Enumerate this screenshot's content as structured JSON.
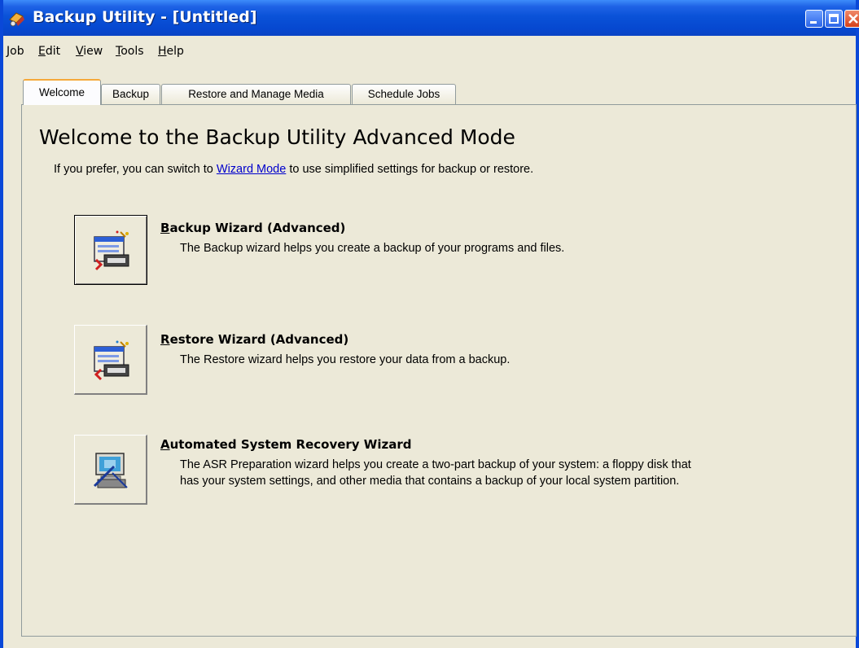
{
  "window": {
    "title": "Backup Utility - [Untitled]",
    "icon": "backup-utility-icon",
    "title_bar_color": "#0a52d8"
  },
  "menu": {
    "items": [
      {
        "first": "J",
        "rest": "ob"
      },
      {
        "first": "E",
        "rest": "dit"
      },
      {
        "first": "V",
        "rest": "iew"
      },
      {
        "first": "T",
        "rest": "ools"
      },
      {
        "first": "H",
        "rest": "elp"
      }
    ]
  },
  "tabs": [
    {
      "label": "Welcome"
    },
    {
      "label": "Backup"
    },
    {
      "label": "Restore and Manage Media"
    },
    {
      "label": "Schedule Jobs"
    }
  ],
  "welcome": {
    "heading": "Welcome to the Backup Utility Advanced Mode",
    "intro_before": "If you prefer, you can switch to ",
    "intro_link": "Wizard Mode",
    "intro_after": " to use simplified settings for backup or restore."
  },
  "wizards": [
    {
      "icon": "backup-wizard-icon",
      "title_first": "B",
      "title_rest": "ackup Wizard (Advanced)",
      "description": "The Backup wizard helps you create a backup of your programs and files."
    },
    {
      "icon": "restore-wizard-icon",
      "title_first": "R",
      "title_rest": "estore Wizard (Advanced)",
      "description": "The Restore wizard helps you restore your data from a backup."
    },
    {
      "icon": "asr-wizard-icon",
      "title_first": "A",
      "title_rest": "utomated System Recovery Wizard",
      "description_line1": "The ASR Preparation wizard helps you create a two-part backup of your system: a floppy disk that",
      "description_line2": "has your system settings, and other media that contains a backup of your local system partition."
    }
  ]
}
